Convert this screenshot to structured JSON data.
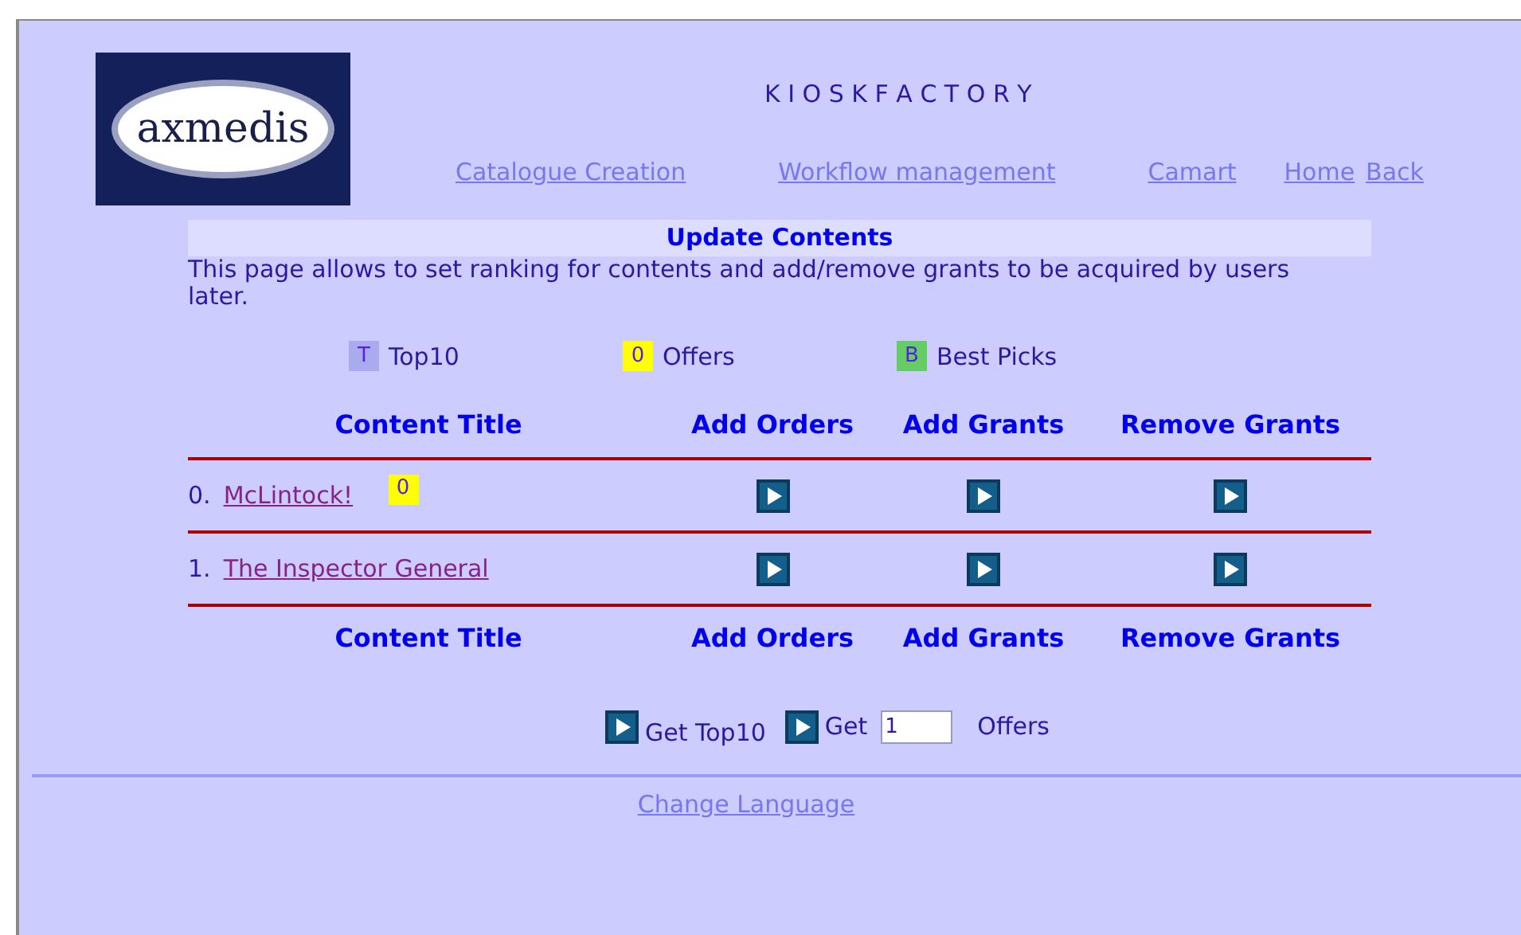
{
  "logo": {
    "text": "axmedis"
  },
  "site_title": "K I O S K F A C T O R Y",
  "nav": [
    "Catalogue Creation",
    "Workflow management",
    "Camart",
    "Home",
    "Back"
  ],
  "section_title": "Update Contents",
  "description": "This page allows to set ranking for contents and add/remove grants to be acquired by users later.",
  "legend": [
    {
      "mark": "T",
      "label": "Top10",
      "color": "#aaaaee"
    },
    {
      "mark": "0",
      "label": "Offers",
      "color": "#ffff00"
    },
    {
      "mark": "B",
      "label": "Best Picks",
      "color": "#66cc66"
    }
  ],
  "table": {
    "columns": [
      "Content Title",
      "Add Orders",
      "Add Grants",
      "Remove Grants"
    ],
    "rows": [
      {
        "index": "0.",
        "title": "McLintock!",
        "badge": {
          "mark": "0",
          "color": "#ffff00"
        }
      },
      {
        "index": "1.",
        "title": "The Inspector General"
      }
    ],
    "footer_columns": [
      "Content Title",
      "Add Orders",
      "Add Grants",
      "Remove Grants"
    ]
  },
  "actions": {
    "get_top10": "Get Top10",
    "get": "Get",
    "count": "1",
    "offers": "Offers"
  },
  "footer_link": "Change Language"
}
